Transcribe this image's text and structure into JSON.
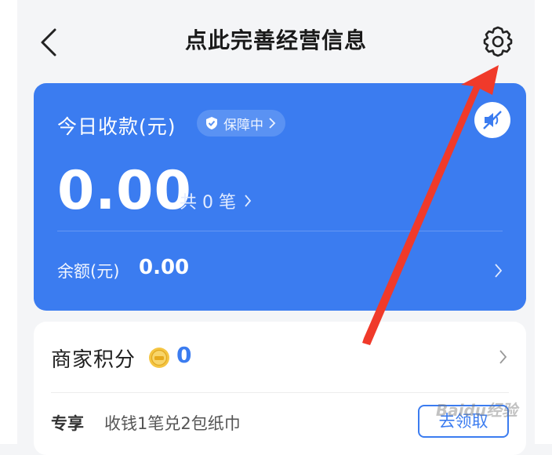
{
  "header": {
    "title": "点此完善经营信息",
    "back_icon": "chevron-left-icon",
    "settings_icon": "gear-icon"
  },
  "income_card": {
    "label": "今日收款(元)",
    "guarantee_badge": "保障中",
    "amount": "0.00",
    "tx_count": "共 0 笔",
    "balance_label": "余额(元)",
    "balance_value": "0.00",
    "sound_icon": "speaker-muted-icon",
    "accent_color": "#3b7cf0"
  },
  "points_card": {
    "label": "商家积分",
    "value": "0",
    "coin_icon": "gold-coin-icon"
  },
  "promo": {
    "tag": "专享",
    "text": "收钱1笔兑2包纸巾",
    "button_label": "去领取"
  },
  "watermark": {
    "text": "Baidu经验"
  },
  "annotation": {
    "color": "#f03a2a"
  }
}
